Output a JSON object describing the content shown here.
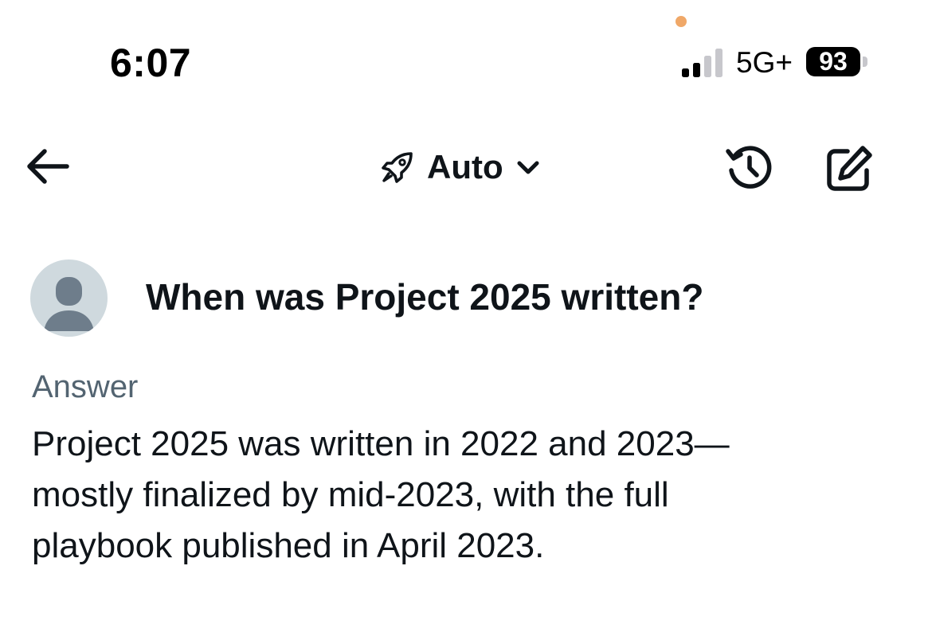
{
  "status_bar": {
    "time": "6:07",
    "network": "5G+",
    "battery": "93",
    "signal_bars": 2,
    "signal_bars_total": 4
  },
  "nav": {
    "model_label": "Auto",
    "icons": [
      "back-arrow-icon",
      "rocket-icon",
      "chevron-down-icon",
      "history-icon",
      "compose-icon"
    ]
  },
  "question": {
    "text": "When was Project 2025 written?"
  },
  "answer": {
    "heading": "Answer",
    "lines": [
      "Project 2025 was written in 2022 and 2023—",
      "mostly finalized by mid-2023, with the full",
      "playbook published in April 2023."
    ]
  },
  "colors": {
    "text_primary": "#0f1419",
    "text_secondary": "#536471",
    "avatar_bg": "#cfd9de",
    "avatar_fg": "#6e7d8b",
    "privacy_dot": "#f0a868"
  }
}
